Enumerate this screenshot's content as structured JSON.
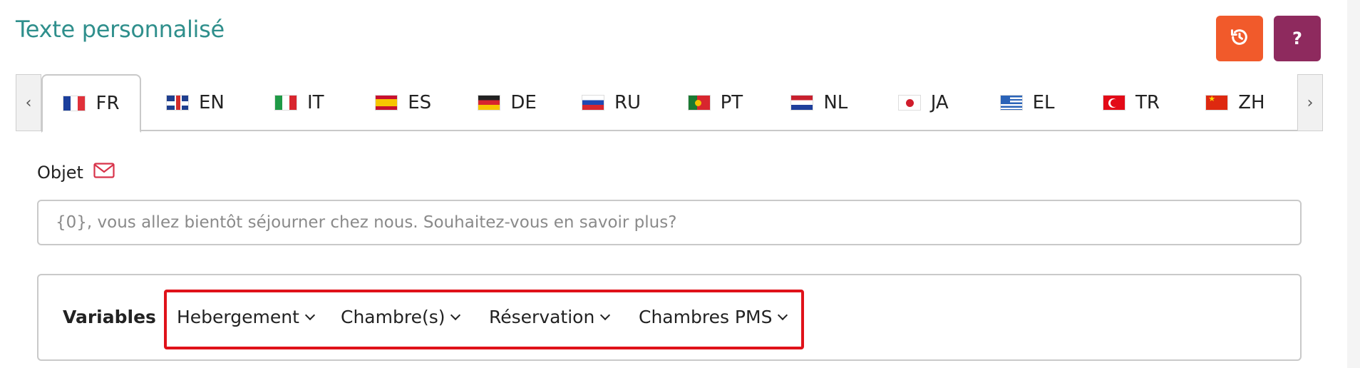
{
  "header": {
    "title": "Texte personnalisé",
    "history_icon": "history-icon",
    "help_label": "?"
  },
  "colors": {
    "title": "#2f8f8c",
    "history_button": "#f15a2b",
    "help_button": "#8e2a5e",
    "highlight": "#e0121a"
  },
  "tabs": {
    "prev_label": "‹",
    "next_label": "›",
    "items": [
      {
        "code": "FR",
        "flag": "flag-fr",
        "active": true
      },
      {
        "code": "EN",
        "flag": "flag-en",
        "active": false
      },
      {
        "code": "IT",
        "flag": "flag-it",
        "active": false
      },
      {
        "code": "ES",
        "flag": "flag-es",
        "active": false
      },
      {
        "code": "DE",
        "flag": "flag-de",
        "active": false
      },
      {
        "code": "RU",
        "flag": "flag-ru",
        "active": false
      },
      {
        "code": "PT",
        "flag": "flag-pt",
        "active": false
      },
      {
        "code": "NL",
        "flag": "flag-nl",
        "active": false
      },
      {
        "code": "JA",
        "flag": "flag-ja",
        "active": false
      },
      {
        "code": "EL",
        "flag": "flag-el",
        "active": false
      },
      {
        "code": "TR",
        "flag": "flag-tr",
        "active": false
      },
      {
        "code": "ZH",
        "flag": "flag-zh",
        "active": false
      }
    ]
  },
  "objet": {
    "label": "Objet",
    "icon": "mail-icon",
    "placeholder": "{0}, vous allez bientôt séjourner chez nous. Souhaitez-vous en savoir plus?"
  },
  "variables": {
    "label": "Variables",
    "menus": [
      "Hebergement",
      "Chambre(s)",
      "Réservation",
      "Chambres PMS"
    ]
  }
}
